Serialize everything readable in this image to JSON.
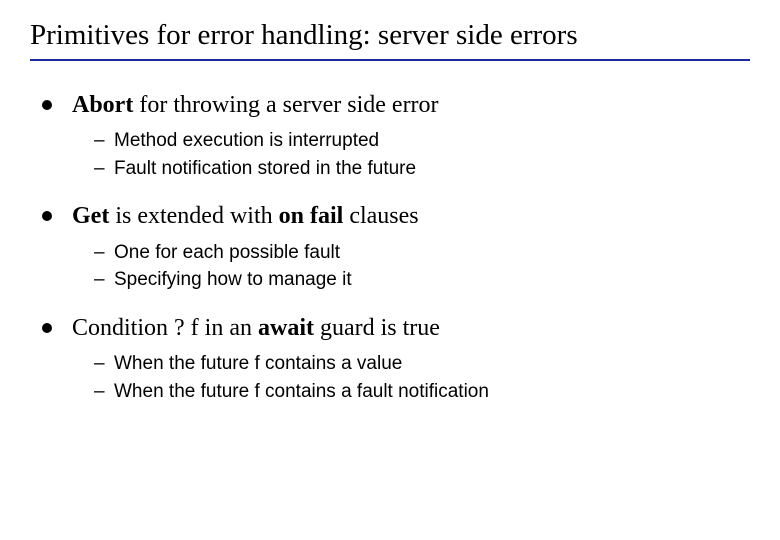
{
  "title": "Primitives for error handling: server side errors",
  "items": [
    {
      "parts": [
        {
          "t": "Abort",
          "b": true
        },
        {
          "t": " for throwing a server side error",
          "b": false
        }
      ],
      "sub": [
        "Method execution is interrupted",
        "Fault notification stored in the future"
      ]
    },
    {
      "parts": [
        {
          "t": "Get",
          "b": true
        },
        {
          "t": " is extended with ",
          "b": false
        },
        {
          "t": "on fail",
          "b": true
        },
        {
          "t": " clauses",
          "b": false
        }
      ],
      "sub": [
        "One for each possible fault",
        "Specifying how to manage it"
      ]
    },
    {
      "parts": [
        {
          "t": "Condition ? f  in an ",
          "b": false
        },
        {
          "t": "await",
          "b": true
        },
        {
          "t": " guard is true",
          "b": false
        }
      ],
      "sub": [
        "When the future f contains a value",
        "When the future f contains a fault notification"
      ]
    }
  ]
}
